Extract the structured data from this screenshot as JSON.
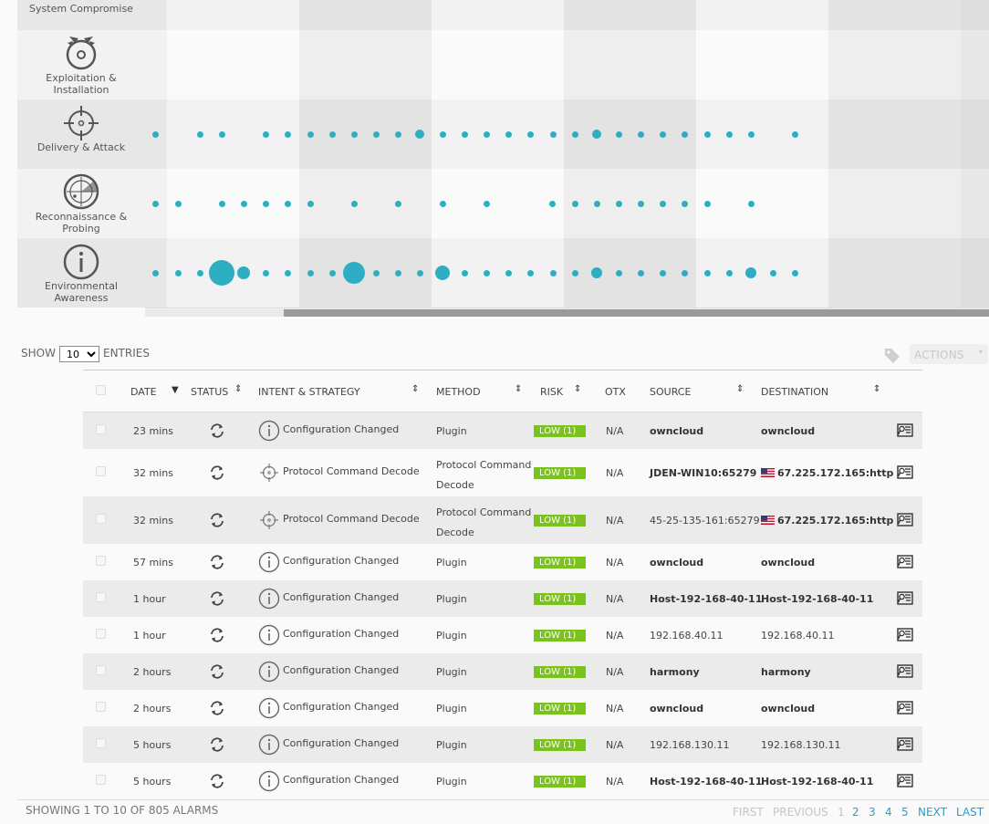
{
  "killchain": {
    "stages": [
      {
        "label": "System Compromise",
        "icon": "system-compromise-icon"
      },
      {
        "label": "Exploitation & Installation",
        "icon": "exploitation-icon"
      },
      {
        "label": "Delivery & Attack",
        "icon": "crosshair-icon"
      },
      {
        "label": "Reconnaissance & Probing",
        "icon": "radar-icon"
      },
      {
        "label": "Environmental Awareness",
        "icon": "info-icon"
      }
    ],
    "dot_color": "#2eaec3"
  },
  "controls": {
    "show_label": "SHOW",
    "entries_value": "10",
    "entries_label": "ENTRIES",
    "actions_label": "ACTIONS"
  },
  "table": {
    "columns": [
      "DATE",
      "STATUS",
      "INTENT & STRATEGY",
      "METHOD",
      "RISK",
      "OTX",
      "SOURCE",
      "DESTINATION"
    ],
    "rows": [
      {
        "date": "23 mins",
        "intent": "Configuration Changed",
        "intent_icon": "info-icon",
        "method": "Plugin",
        "risk": "LOW  (1)",
        "otx": "N/A",
        "source": "owncloud",
        "destination": "owncloud"
      },
      {
        "date": "32 mins",
        "intent": "Protocol Command Decode",
        "intent_icon": "crosshair-icon",
        "method": "Protocol Command Decode",
        "risk": "LOW  (1)",
        "otx": "N/A",
        "source": "JDEN-WIN10:65279",
        "destination": "67.225.172.165:http",
        "dest_flag": "us-flag-icon"
      },
      {
        "date": "32 mins",
        "intent": "Protocol Command Decode",
        "intent_icon": "crosshair-icon",
        "method": "Protocol Command Decode",
        "risk": "LOW  (1)",
        "otx": "N/A",
        "source": "45-25-135-161:65279",
        "destination": "67.225.172.165:http",
        "dest_flag": "us-flag-icon"
      },
      {
        "date": "57 mins",
        "intent": "Configuration Changed",
        "intent_icon": "info-icon",
        "method": "Plugin",
        "risk": "LOW  (1)",
        "otx": "N/A",
        "source": "owncloud",
        "destination": "owncloud"
      },
      {
        "date": "1 hour",
        "intent": "Configuration Changed",
        "intent_icon": "info-icon",
        "method": "Plugin",
        "risk": "LOW  (1)",
        "otx": "N/A",
        "source": "Host-192-168-40-11",
        "destination": "Host-192-168-40-11"
      },
      {
        "date": "1 hour",
        "intent": "Configuration Changed",
        "intent_icon": "info-icon",
        "method": "Plugin",
        "risk": "LOW  (1)",
        "otx": "N/A",
        "source": "192.168.40.11",
        "destination": "192.168.40.11"
      },
      {
        "date": "2 hours",
        "intent": "Configuration Changed",
        "intent_icon": "info-icon",
        "method": "Plugin",
        "risk": "LOW  (1)",
        "otx": "N/A",
        "source": "harmony",
        "destination": "harmony"
      },
      {
        "date": "2 hours",
        "intent": "Configuration Changed",
        "intent_icon": "info-icon",
        "method": "Plugin",
        "risk": "LOW  (1)",
        "otx": "N/A",
        "source": "owncloud",
        "destination": "owncloud"
      },
      {
        "date": "5 hours",
        "intent": "Configuration Changed",
        "intent_icon": "info-icon",
        "method": "Plugin",
        "risk": "LOW  (1)",
        "otx": "N/A",
        "source": "192.168.130.11",
        "destination": "192.168.130.11"
      },
      {
        "date": "5 hours",
        "intent": "Configuration Changed",
        "intent_icon": "info-icon",
        "method": "Plugin",
        "risk": "LOW  (1)",
        "otx": "N/A",
        "source": "Host-192-168-40-11",
        "destination": "Host-192-168-40-11"
      }
    ]
  },
  "footer": {
    "showing": "SHOWING 1 TO 10 OF 805 ALARMS",
    "first": "FIRST",
    "previous": "PREVIOUS",
    "pages": [
      "1",
      "2",
      "3",
      "4",
      "5"
    ],
    "next": "NEXT",
    "last": "LAST"
  },
  "colors": {
    "accent": "#2eaec3",
    "risk_low": "#7cc21f",
    "link": "#2a9ccf"
  }
}
